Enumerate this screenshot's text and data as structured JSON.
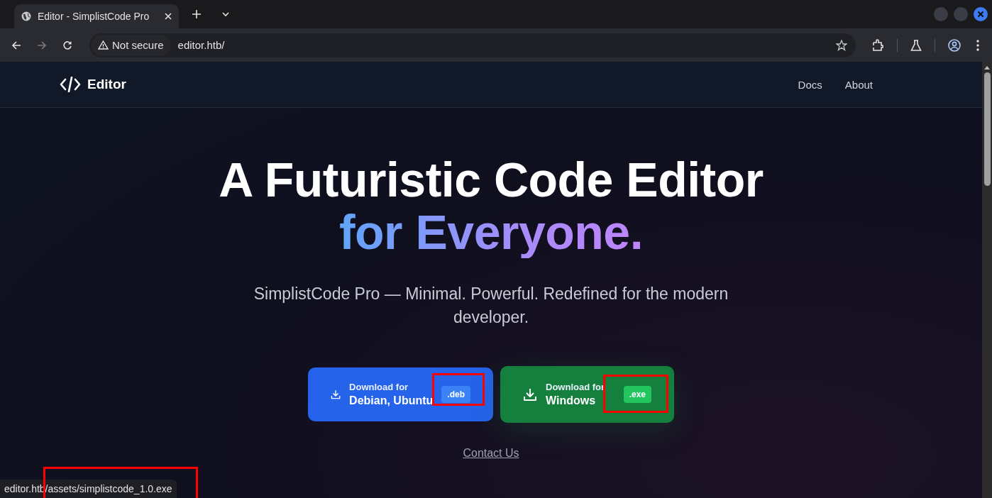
{
  "browser": {
    "tabs": [
      {
        "title": "Editor - SimplistCode Pro",
        "selected": true
      }
    ],
    "security_label": "Not secure",
    "url": "editor.htb/"
  },
  "site": {
    "logo": "Editor",
    "nav": [
      "Docs",
      "About"
    ]
  },
  "hero": {
    "title": "A Futuristic Code Editor",
    "title_accent": "for Everyone.",
    "subtitle": "SimplistCode Pro — Minimal. Powerful. Redefined for the modern developer."
  },
  "downloads": [
    {
      "kind": "linux",
      "caption": "Download for",
      "platform": "Debian, Ubuntu",
      "badge": ".deb",
      "highlighted": true
    },
    {
      "kind": "windows",
      "caption": "Download for",
      "platform": "Windows",
      "badge": ".exe",
      "highlighted": true
    }
  ],
  "contact_link": "Contact Us",
  "status_bar": {
    "text": "editor.htb/assets/simplistcode_1.0.exe",
    "highlighted": true
  }
}
